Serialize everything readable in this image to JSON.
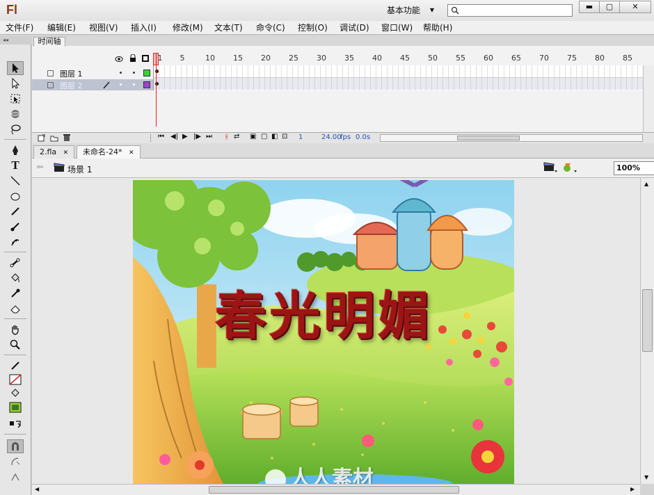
{
  "app": {
    "logo": "Fl",
    "workspace": "基本功能",
    "window_min": "▬",
    "window_max": "▢",
    "window_close": "✕"
  },
  "menu": [
    "文件(F)",
    "编辑(E)",
    "视图(V)",
    "插入(I)",
    "修改(M)",
    "文本(T)",
    "命令(C)",
    "控制(O)",
    "调试(D)",
    "窗口(W)",
    "帮助(H)"
  ],
  "timeline": {
    "tab": "时间轴",
    "ruler": [
      "1",
      "5",
      "10",
      "15",
      "20",
      "25",
      "30",
      "35",
      "40",
      "45",
      "50",
      "55",
      "60",
      "65",
      "70",
      "75",
      "80",
      "85"
    ],
    "layers": [
      {
        "name": "图层 1",
        "color": "#39d13a"
      },
      {
        "name": "图层 2",
        "color": "#a23fd1"
      }
    ],
    "current_frame": "1",
    "fps": "24.00",
    "fps_unit": "fps",
    "time": "0.0",
    "time_unit": "s"
  },
  "documents": [
    {
      "label": "2.fla"
    },
    {
      "label": "未命名-24*"
    }
  ],
  "scene": {
    "label": "场景 1",
    "zoom": "100%"
  },
  "stage": {
    "banner": "春光明媚",
    "watermark": "人人素材"
  },
  "colors": {
    "accent_red": "#9b1515",
    "sky": "#bfe5f5",
    "grass": "#9bd23a"
  }
}
